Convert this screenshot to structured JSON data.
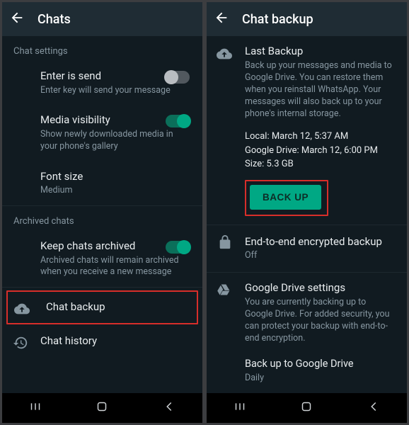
{
  "left": {
    "title": "Chats",
    "section1": "Chat settings",
    "enter_is_send": {
      "title": "Enter is send",
      "sub": "Enter key will send your message",
      "on": false
    },
    "media_visibility": {
      "title": "Media visibility",
      "sub": "Show newly downloaded media in your phone's gallery",
      "on": true
    },
    "font_size": {
      "title": "Font size",
      "sub": "Medium"
    },
    "section2": "Archived chats",
    "keep_archived": {
      "title": "Keep chats archived",
      "sub": "Archived chats will remain archived when you receive a new message",
      "on": true
    },
    "chat_backup": "Chat backup",
    "chat_history": "Chat history"
  },
  "right": {
    "title": "Chat backup",
    "last_backup": {
      "title": "Last Backup",
      "desc": "Back up your messages and media to Google Drive. You can restore them when you reinstall WhatsApp. Your messages will also back up to your phone's internal storage.",
      "local": "Local: March 12, 5:37 AM",
      "drive": "Google Drive: March 12, 6:00 PM",
      "size": "Size: 5.3 GB",
      "button": "BACK UP"
    },
    "e2e": {
      "title": "End-to-end encrypted backup",
      "sub": "Off"
    },
    "gd": {
      "title": "Google Drive settings",
      "desc": "You are currently backing up to Google Drive. For added security, you can protect your backup with end-to-end encryption.",
      "freq_title": "Back up to Google Drive",
      "freq_sub": "Daily"
    }
  },
  "colors": {
    "accent": "#00a884",
    "highlight": "#d72e2a"
  }
}
